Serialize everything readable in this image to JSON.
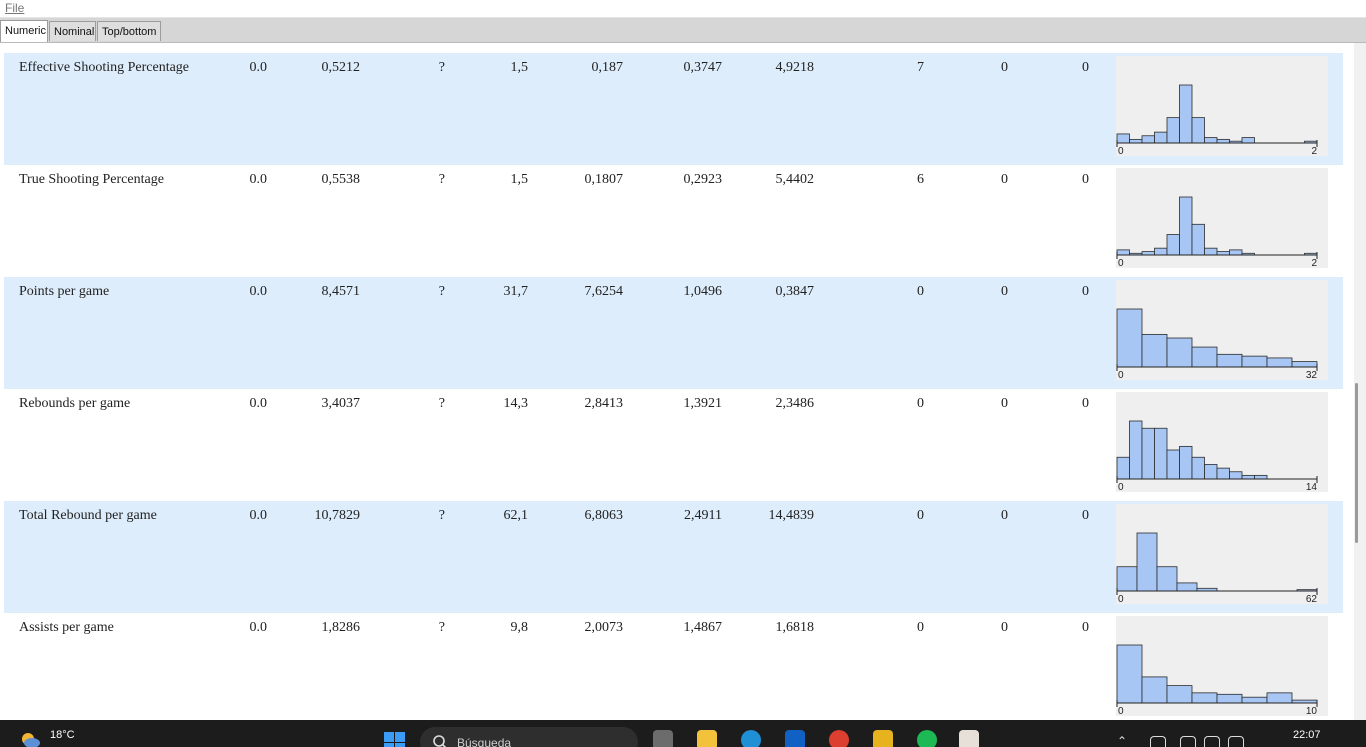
{
  "menu": {
    "file": "File"
  },
  "tabs": [
    {
      "label": "Numeric",
      "active": true
    },
    {
      "label": "Nominal",
      "active": false
    },
    {
      "label": "Top/bottom",
      "active": false
    }
  ],
  "rows": [
    {
      "name": "Effective Shooting Percentage",
      "v": [
        "0.0",
        "0,5212",
        "?",
        "1,5",
        "0,187",
        "0,3747",
        "4,9218",
        "7",
        "0",
        "0"
      ],
      "hist": {
        "min": "0",
        "max": "2",
        "counts": [
          5,
          2,
          4,
          6,
          14,
          32,
          14,
          3,
          2,
          1,
          3,
          0,
          0,
          0,
          0,
          1
        ]
      }
    },
    {
      "name": "True Shooting Percentage",
      "v": [
        "0.0",
        "0,5538",
        "?",
        "1,5",
        "0,1807",
        "0,2923",
        "5,4402",
        "6",
        "0",
        "0"
      ],
      "hist": {
        "min": "0",
        "max": "2",
        "counts": [
          3,
          1,
          2,
          4,
          12,
          34,
          18,
          4,
          2,
          3,
          1,
          0,
          0,
          0,
          0,
          1
        ]
      }
    },
    {
      "name": "Points per game",
      "v": [
        "0.0",
        "8,4571",
        "?",
        "31,7",
        "7,6254",
        "1,0496",
        "0,3847",
        "0",
        "0",
        "0"
      ],
      "hist": {
        "min": "0",
        "max": "32",
        "counts": [
          32,
          18,
          16,
          11,
          7,
          6,
          5,
          3
        ]
      }
    },
    {
      "name": "Rebounds per game",
      "v": [
        "0.0",
        "3,4037",
        "?",
        "14,3",
        "2,8413",
        "1,3921",
        "2,3486",
        "0",
        "0",
        "0"
      ],
      "hist": {
        "min": "0",
        "max": "14",
        "counts": [
          6,
          16,
          14,
          14,
          8,
          9,
          6,
          4,
          3,
          2,
          1,
          1,
          0,
          0,
          0,
          0
        ]
      }
    },
    {
      "name": "Total Rebound per game",
      "v": [
        "0.0",
        "10,7829",
        "?",
        "62,1",
        "6,8063",
        "2,4911",
        "14,4839",
        "0",
        "0",
        "0"
      ],
      "hist": {
        "min": "0",
        "max": "62",
        "counts": [
          18,
          43,
          18,
          6,
          2,
          0,
          0,
          0,
          0,
          1
        ]
      }
    },
    {
      "name": "Assists per game",
      "v": [
        "0.0",
        "1,8286",
        "?",
        "9,8",
        "2,0073",
        "1,4867",
        "1,6818",
        "0",
        "0",
        "0"
      ],
      "hist": {
        "min": "0",
        "max": "10",
        "counts": [
          40,
          18,
          12,
          7,
          6,
          4,
          7,
          2
        ]
      }
    }
  ],
  "colors": {
    "row_shade": "#deedfc",
    "bar_fill": "#a7c6f4",
    "hist_bg": "#efefef"
  },
  "taskbar": {
    "temperature": "18°C",
    "search_placeholder": "Búsqueda",
    "time": "22:07"
  }
}
